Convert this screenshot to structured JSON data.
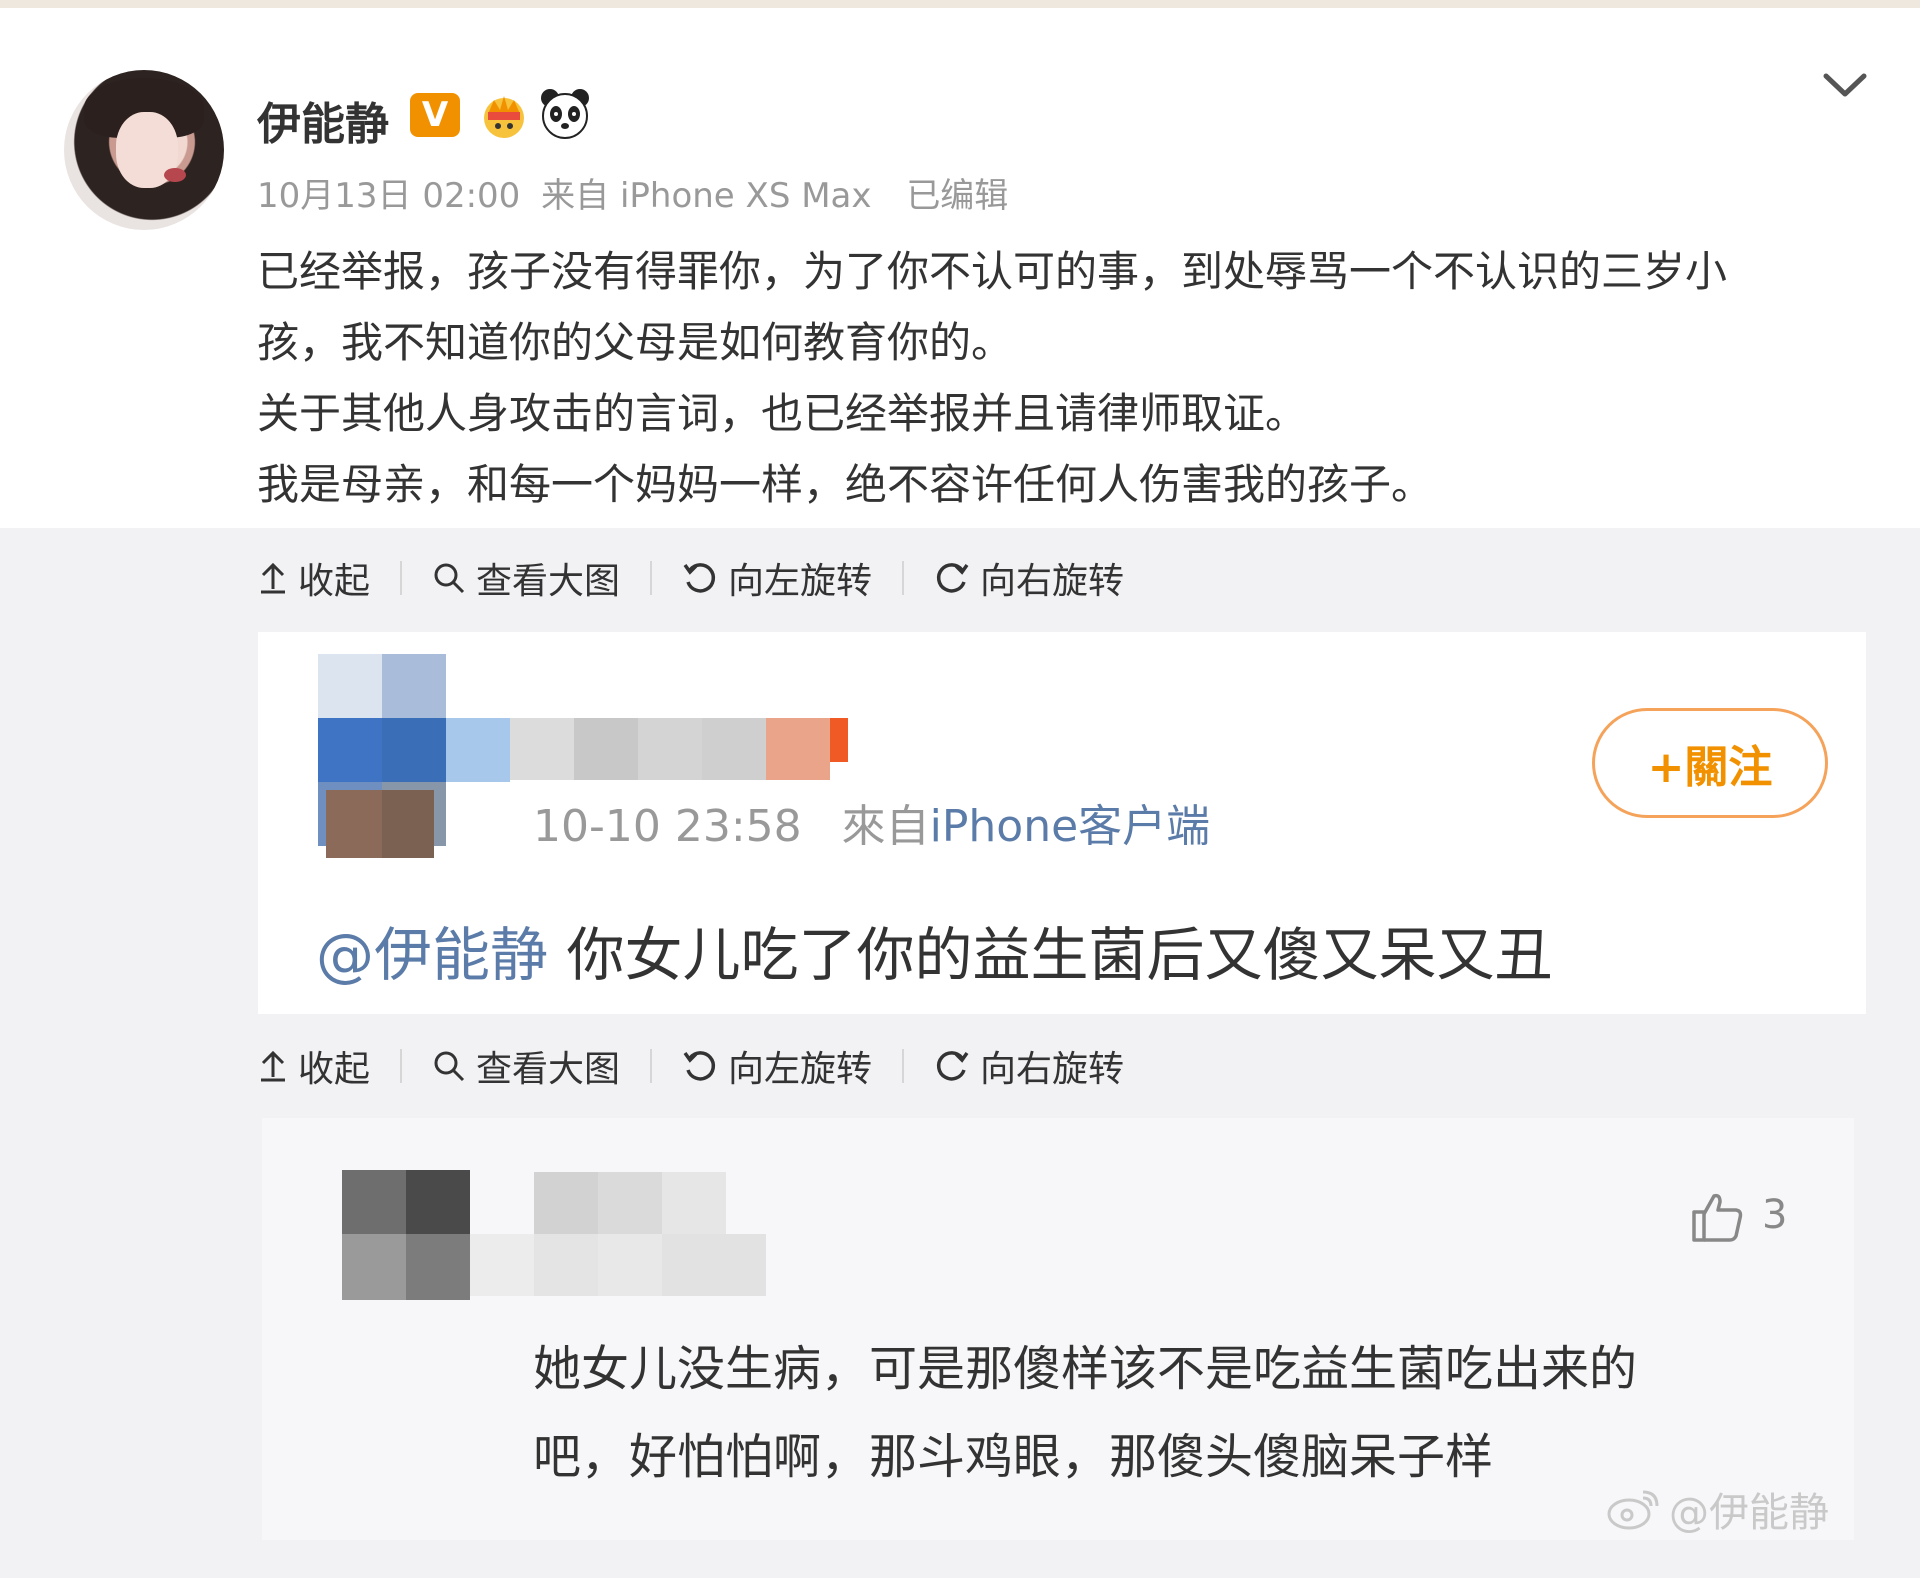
{
  "post": {
    "username": "伊能静",
    "verified_badge": "V",
    "timestamp": "10月13日 02:00",
    "source": "来自 iPhone XS Max",
    "edited": "已编辑",
    "lines": [
      "已经举报，孩子没有得罪你，为了你不认可的事，到处辱骂一个不认识的三岁小",
      "孩，我不知道你的父母是如何教育你的。",
      "关于其他人身攻击的言词，也已经举报并且请律师取证。",
      "我是母亲，和每一个妈妈一样，绝不容许任何人伤害我的孩子。"
    ]
  },
  "toolbar1": {
    "collapse": "收起",
    "view_large": "查看大图",
    "rotate_left": "向左旋转",
    "rotate_right": "向右旋转"
  },
  "toolbar2": {
    "collapse": "收起",
    "view_large": "查看大图",
    "rotate_left": "向左旋转",
    "rotate_right": "向右旋转"
  },
  "screenshot1": {
    "follow_label": "+關注",
    "time": "10-10 23:58",
    "source_prefix": "來自",
    "source": "iPhone客户端",
    "mention": "@伊能静",
    "text": " 你女儿吃了你的益生菌后又傻又呆又丑"
  },
  "screenshot2": {
    "like_count": "3",
    "lines": [
      "她女儿没生病，可是那傻样该不是吃益生菌吃出来的",
      "吧，好怕怕啊，那斗鸡眼，那傻头傻脑呆子样"
    ]
  },
  "watermark": "@伊能静",
  "icons": {
    "chevron": "chevron-down-icon",
    "crown": "crown-icon",
    "panda": "panda-icon",
    "collapse": "arrow-up-icon",
    "search": "search-icon",
    "rotate_left": "rotate-left-icon",
    "rotate_right": "rotate-right-icon",
    "like": "thumbs-up-icon"
  },
  "colors": {
    "accent_orange": "#f29100",
    "link_blue": "#5b7ba8",
    "meta_gray": "#999999"
  }
}
